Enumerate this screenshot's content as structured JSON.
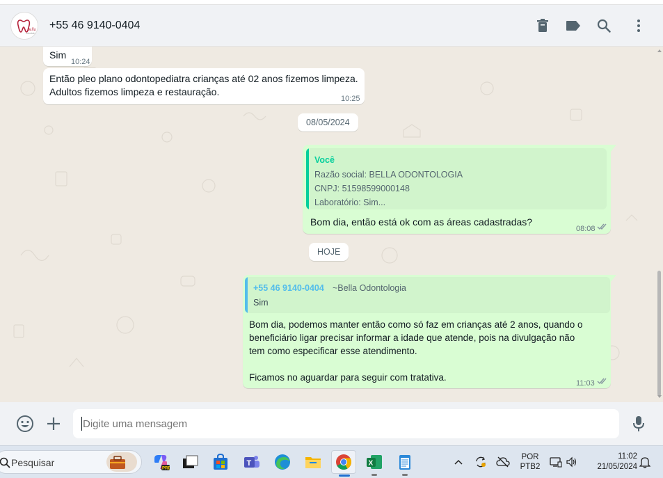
{
  "header": {
    "contact_name": "+55 46 9140-0404",
    "avatar_alt": "Bella Odontologia logo"
  },
  "header_icons": [
    "trash-icon",
    "label-icon",
    "search-icon",
    "menu-icon"
  ],
  "messages": [
    {
      "direction": "in",
      "text": "Sim",
      "time": "10:24"
    },
    {
      "direction": "in",
      "lines": [
        "Então pleo plano odontopediatra crianças até 02 anos fizemos limpeza.",
        "Adultos fizemos limpeza e restauração."
      ],
      "time": "10:25"
    }
  ],
  "date_separators": [
    "08/05/2024",
    "HOJE"
  ],
  "reply_1": {
    "quote_author": "Você",
    "quote_lines": [
      "Razão social: BELLA ODONTOLOGIA",
      "CNPJ: 51598599000148",
      "Laboratório: Sim..."
    ],
    "text": "Bom dia, então está ok com as áreas cadastradas?",
    "time": "08:08"
  },
  "reply_2": {
    "quote_author": "+55 46 9140-0404",
    "quote_author_name": "~Bella Odontologia",
    "quote_lines": [
      "Sim"
    ],
    "lines": [
      "Bom dia, podemos manter então como só faz em crianças até 2 anos, quando o",
      "beneficiário ligar precisar informar a idade que atende, pois na divulgação não",
      "tem como especificar esse atendimento.",
      "",
      "Ficamos no aguardar para seguir com tratativa."
    ],
    "time": "11:03"
  },
  "input": {
    "placeholder": "Digite uma mensagem"
  },
  "taskbar": {
    "search_label": "Pesquisar",
    "lang_top": "POR",
    "lang_bottom": "PTB2",
    "clock_time": "11:02",
    "clock_date": "21/05/2024"
  },
  "colors": {
    "chat_bg": "#efeae2",
    "outgoing_bubble": "#d9fdd3",
    "incoming_bubble": "#ffffff",
    "you_accent": "#06cf9c",
    "contact_accent": "#53bdeb",
    "tick_color": "#8696a0"
  }
}
